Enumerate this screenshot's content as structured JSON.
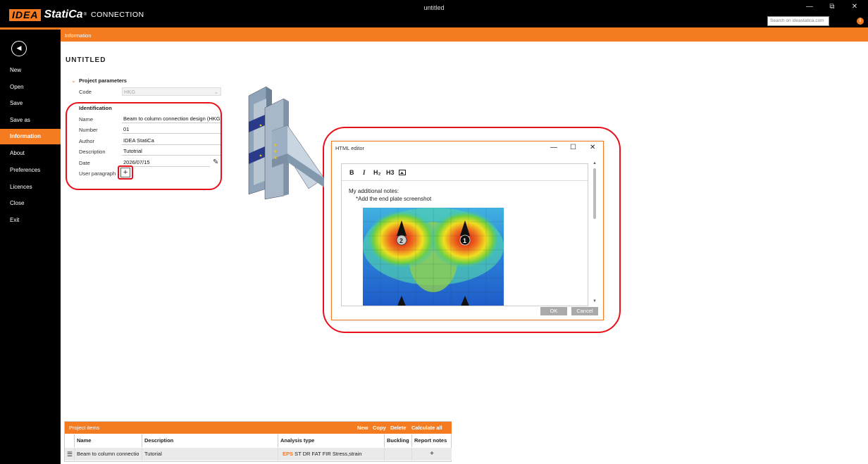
{
  "window": {
    "title": "untitled",
    "logo_idea": "IDEA",
    "logo_statica": "StatiCa",
    "logo_reg": "®",
    "logo_product": "CONNECTION",
    "minimize": "—",
    "restore": "⧉",
    "close": "✕",
    "search_placeholder": "Search on ideastatica.com",
    "info_glyph": "i"
  },
  "sidebar": {
    "back_glyph": "◀",
    "items": [
      {
        "label": "New"
      },
      {
        "label": "Open"
      },
      {
        "label": "Save"
      },
      {
        "label": "Save as"
      },
      {
        "label": "Information"
      },
      {
        "label": "About"
      },
      {
        "label": "Preferences"
      },
      {
        "label": "Licences"
      },
      {
        "label": "Close"
      },
      {
        "label": "Exit"
      }
    ],
    "active": "Information"
  },
  "header": {
    "band": "Information",
    "page_title": "UNTITLED"
  },
  "project_parameters": {
    "title": "Project parameters",
    "code_label": "Code",
    "code_value": "HKG"
  },
  "identification": {
    "title": "Identification",
    "name_label": "Name",
    "name_value": "Beam to column connection design (HKG)",
    "number_label": "Number",
    "number_value": "01",
    "author_label": "Author",
    "author_value": "IDEA StatiCa",
    "description_label": "Description",
    "description_value": "Tutotrial",
    "date_label": "Date",
    "date_value": "2026/07/15",
    "user_paragraph_label": "User paragraph",
    "add_glyph": "+"
  },
  "dialog": {
    "title": "HTML editor",
    "toolbar": {
      "bold": "B",
      "italic": "I",
      "h2": "H₂",
      "h3": "H3"
    },
    "note_line1": "My additional notes:",
    "note_line2": "*Add the end plate screenshot",
    "ok": "OK",
    "cancel": "Cancel"
  },
  "project_items": {
    "title": "Project items",
    "actions": {
      "new": "New",
      "copy": "Copy",
      "delete": "Delete",
      "calculate_all": "Calculate all"
    },
    "columns": {
      "name": "Name",
      "description": "Description",
      "analysis_type": "Analysis type",
      "buckling": "Buckling",
      "report_notes": "Report notes"
    },
    "rows": [
      {
        "name": "Beam to column connectio",
        "description": "Tutorial",
        "analysis_eps": "EPS",
        "analysis_rest": "ST  DR  FAT  FIR  Stress,strain",
        "report_add": "+"
      }
    ]
  },
  "colors": {
    "accent": "#f47b20",
    "highlight_red": "#e8101a",
    "sidebar_bg": "#000000"
  },
  "icons": [
    "back-icon",
    "pencil-icon",
    "image-icon",
    "info-icon",
    "menu-icon"
  ]
}
